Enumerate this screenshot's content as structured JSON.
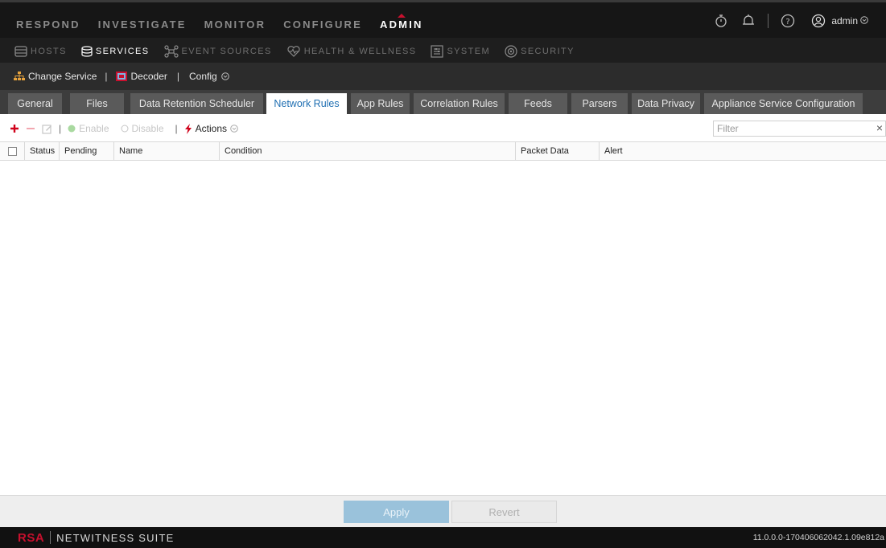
{
  "main_nav": {
    "items": [
      {
        "label": "RESPOND",
        "active": false
      },
      {
        "label": "INVESTIGATE",
        "active": false
      },
      {
        "label": "MONITOR",
        "active": false
      },
      {
        "label": "CONFIGURE",
        "active": false
      },
      {
        "label": "ADMIN",
        "active": true
      }
    ]
  },
  "top_right": {
    "icons": [
      "stopwatch-icon",
      "bell-icon",
      "help-icon",
      "user-icon"
    ],
    "user_label": "admin"
  },
  "sub_nav": {
    "items": [
      {
        "label": "HOSTS",
        "icon": "hosts-icon",
        "active": false
      },
      {
        "label": "SERVICES",
        "icon": "services-icon",
        "active": true
      },
      {
        "label": "EVENT SOURCES",
        "icon": "event-sources-icon",
        "active": false
      },
      {
        "label": "HEALTH & WELLNESS",
        "icon": "health-icon",
        "active": false
      },
      {
        "label": "SYSTEM",
        "icon": "system-icon",
        "active": false
      },
      {
        "label": "SECURITY",
        "icon": "security-icon",
        "active": false
      }
    ]
  },
  "service_bar": {
    "change_service": "Change Service",
    "decoder": "Decoder",
    "config": "Config"
  },
  "tabs": [
    {
      "label": "General",
      "active": false
    },
    {
      "label": "Files",
      "active": false
    },
    {
      "label": "Data Retention Scheduler",
      "active": false
    },
    {
      "label": "Network Rules",
      "active": true
    },
    {
      "label": "App Rules",
      "active": false
    },
    {
      "label": "Correlation Rules",
      "active": false
    },
    {
      "label": "Feeds",
      "active": false
    },
    {
      "label": "Parsers",
      "active": false
    },
    {
      "label": "Data Privacy",
      "active": false
    },
    {
      "label": "Appliance Service Configuration",
      "active": false
    }
  ],
  "grid_toolbar": {
    "enable": "Enable",
    "disable": "Disable",
    "actions": "Actions",
    "filter_placeholder": "Filter"
  },
  "table": {
    "columns": [
      "Status",
      "Pending",
      "Name",
      "Condition",
      "Packet Data",
      "Alert"
    ],
    "rows": []
  },
  "footer_buttons": {
    "apply": "Apply",
    "revert": "Revert"
  },
  "footer": {
    "brand": "RSA",
    "suite": "NETWITNESS SUITE",
    "version": "11.0.0.0-170406062042.1.09e812a"
  },
  "colors": {
    "accent": "#2196d3",
    "brand_red": "#c8102e",
    "active_tab_text": "#1f6fb2"
  }
}
